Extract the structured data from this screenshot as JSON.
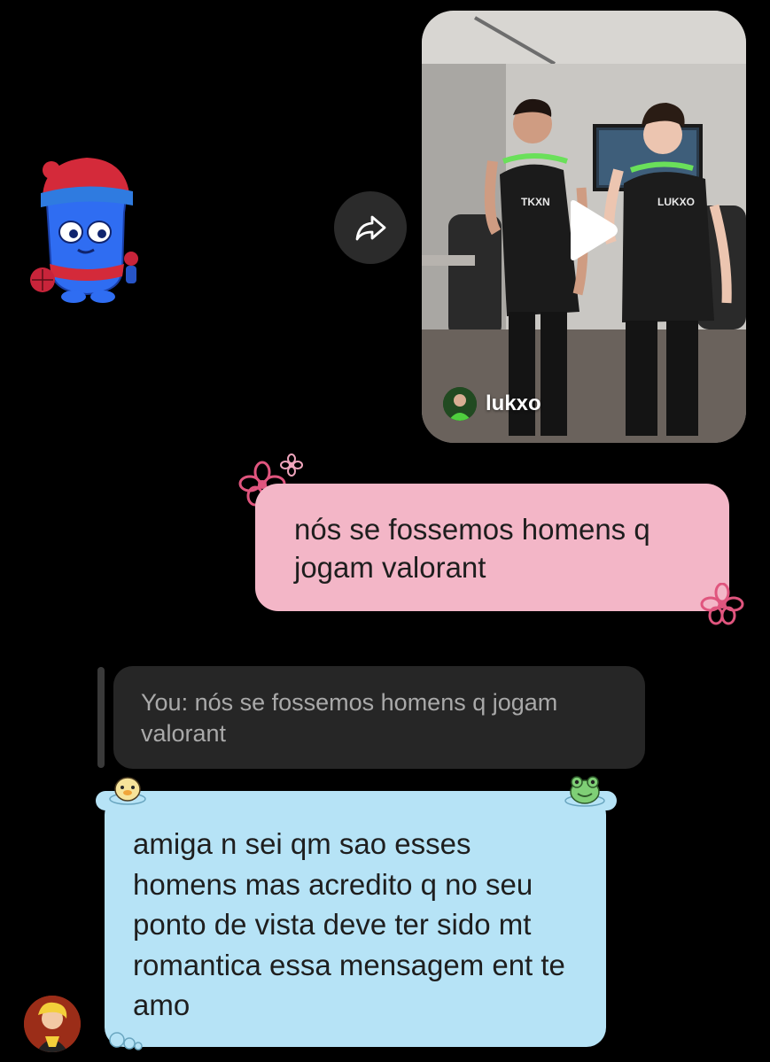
{
  "shared_video": {
    "username": "lukxo",
    "shirt_text_left": "TKXN",
    "shirt_text_right": "LUKXO"
  },
  "messages": {
    "sent_text": "nós se fossemos homens q jogam valorant",
    "reply_quote_text": "You: nós se fossemos homens q jogam valorant",
    "received_text": "amiga n sei qm sao esses homens mas acredito q no seu ponto de vista deve ter sido mt romantica essa mensagem ent te amo"
  },
  "icons": {
    "share": "share-arrow-icon",
    "play": "play-icon",
    "sticker": "spiderman-blue-creature-sticker"
  },
  "colors": {
    "background": "#000000",
    "sent_bubble": "#f3b6c7",
    "received_bubble": "#b6e3f6",
    "reply_bubble": "#262626",
    "reply_text": "#a9a9a9",
    "flower": "#e0557e"
  }
}
